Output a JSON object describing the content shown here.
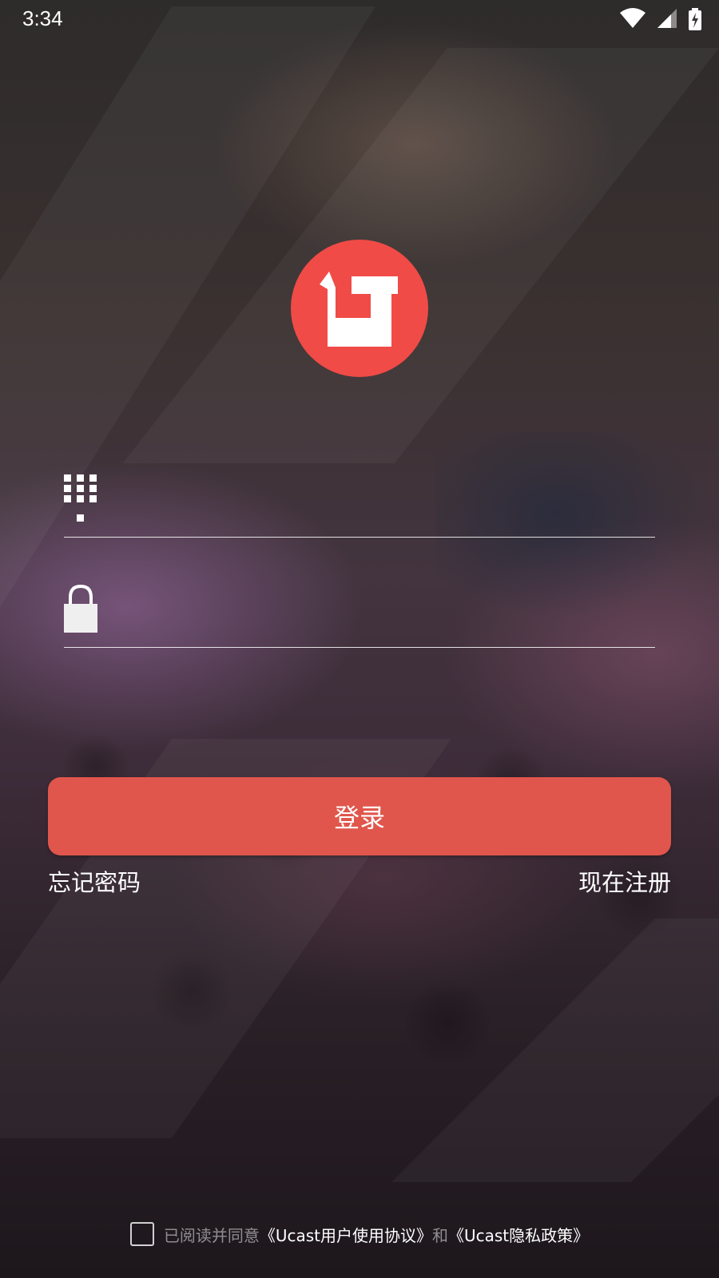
{
  "status_bar": {
    "time": "3:34",
    "icons": [
      "wifi-icon",
      "signal-icon",
      "battery-charging-icon"
    ]
  },
  "logo": {
    "icon": "ucast-u-logo-icon",
    "color": "#f04b47"
  },
  "login_form": {
    "phone_field": {
      "icon": "dialpad-icon",
      "value": "",
      "placeholder": ""
    },
    "password_field": {
      "icon": "lock-icon",
      "value": "",
      "placeholder": ""
    },
    "login_button": {
      "label": "登录",
      "color": "#e0564c"
    },
    "forgot_password_label": "忘记密码",
    "register_label": "现在注册"
  },
  "agreement": {
    "checked": false,
    "prefix": "已阅读并同意",
    "user_agreement_link": "《Ucast用户使用协议》",
    "conjunction": "和",
    "privacy_policy_link": "《Ucast隐私政策》"
  }
}
